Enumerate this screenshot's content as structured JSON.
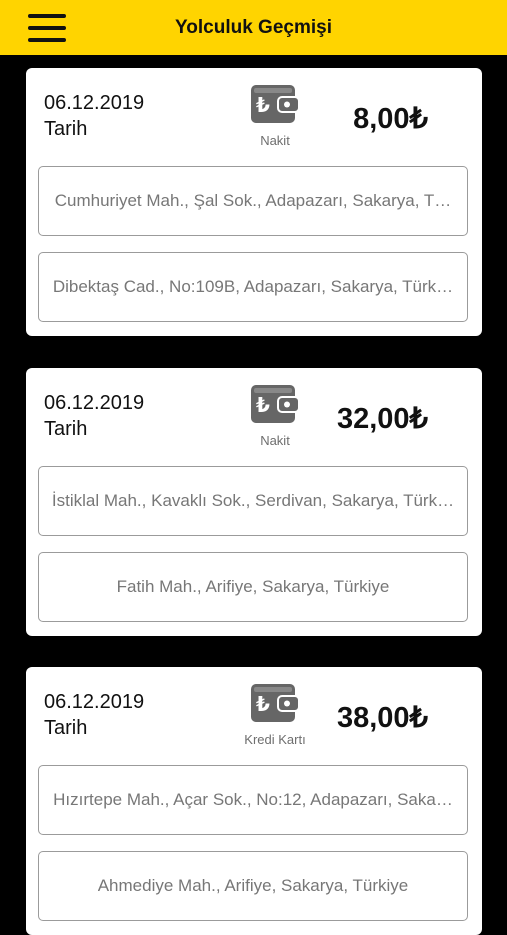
{
  "header": {
    "title": "Yolculuk Geçmişi",
    "background": "#FFD400"
  },
  "icons": {
    "menu": "hamburger-menu-icon",
    "wallet": "lira-wallet-icon"
  },
  "trips": [
    {
      "date": "06.12.2019",
      "date_label": "Tarih",
      "payment_type": "Nakit",
      "price": "8,00₺",
      "from": "Cumhuriyet Mah., Şal Sok., Adapazarı, Sakarya, T…",
      "to": "Dibektaş Cad., No:109B, Adapazarı, Sakarya, Türk…"
    },
    {
      "date": "06.12.2019",
      "date_label": "Tarih",
      "payment_type": "Nakit",
      "price": "32,00₺",
      "from": "İstiklal Mah., Kavaklı Sok., Serdivan, Sakarya, Türk…",
      "to": "Fatih Mah., Arifiye, Sakarya, Türkiye"
    },
    {
      "date": "06.12.2019",
      "date_label": "Tarih",
      "payment_type": "Kredi Kartı",
      "price": "38,00₺",
      "from": "Hızırtepe Mah., Açar Sok., No:12, Adapazarı, Saka…",
      "to": "Ahmediye Mah., Arifiye, Sakarya, Türkiye"
    }
  ]
}
